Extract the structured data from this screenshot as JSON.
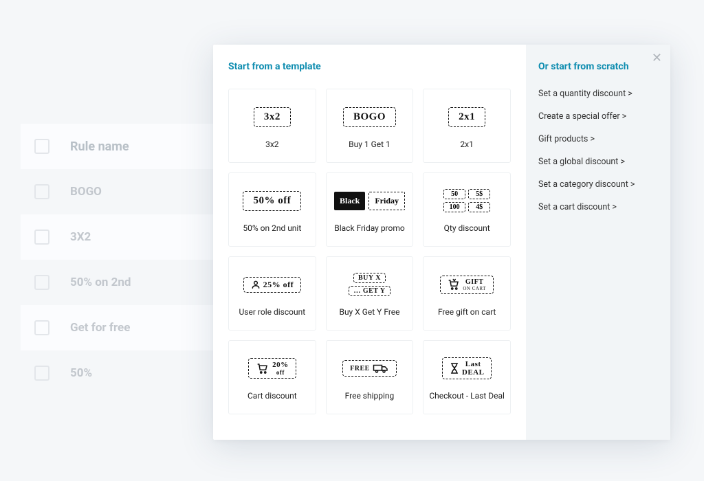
{
  "bg": {
    "header": "Rule name",
    "rows": [
      "BOGO",
      "3X2",
      "50% on 2nd",
      "Get for free",
      "50%"
    ]
  },
  "modal": {
    "left_title": "Start from a template",
    "right_title": "Or start from scratch",
    "templates": [
      {
        "label": "3x2",
        "icon_text": "3x2"
      },
      {
        "label": "Buy 1 Get 1",
        "icon_text": "BOGO"
      },
      {
        "label": "2x1",
        "icon_text": "2x1"
      },
      {
        "label": "50% on 2nd unit",
        "icon_text": "50% off"
      },
      {
        "label": "Black Friday promo",
        "icon_text_a": "Black",
        "icon_text_b": "Friday"
      },
      {
        "label": "Qty discount",
        "q1a": "50",
        "q1b": "5$",
        "q2a": "100",
        "q2b": "4$"
      },
      {
        "label": "User role discount",
        "icon_text": "25% off",
        "icon_glyph": "person"
      },
      {
        "label": "Buy X Get Y Free",
        "top": "BUY X",
        "bot": "… GET Y"
      },
      {
        "label": "Free gift on cart",
        "icon_text": "GIFT",
        "sub": "ON CART",
        "icon_glyph": "cart-gift"
      },
      {
        "label": "Cart discount",
        "icon_text": "20%",
        "sub": "off",
        "icon_glyph": "cart"
      },
      {
        "label": "Free shipping",
        "icon_text": "FREE",
        "icon_glyph": "truck"
      },
      {
        "label": "Checkout - Last Deal",
        "icon_text": "Last",
        "sub": "DEAL",
        "icon_glyph": "hourglass"
      }
    ],
    "links": [
      "Set a quantity discount >",
      "Create a special offer >",
      "Gift products >",
      "Set a global discount >",
      "Set a category discount >",
      "Set a cart discount >"
    ]
  }
}
